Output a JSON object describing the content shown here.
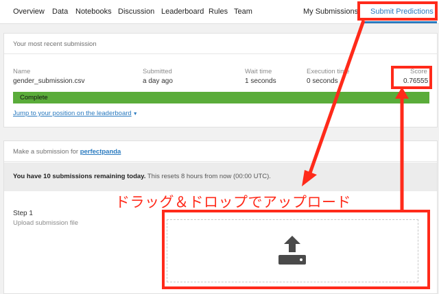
{
  "nav": {
    "items": [
      "Overview",
      "Data",
      "Notebooks",
      "Discussion",
      "Leaderboard",
      "Rules",
      "Team"
    ],
    "my_submissions": "My Submissions",
    "submit_predictions": "Submit Predictions"
  },
  "recent": {
    "header": "Your most recent submission",
    "columns": {
      "name": "Name",
      "submitted": "Submitted",
      "wait_time": "Wait time",
      "execution_time": "Execution time",
      "score": "Score"
    },
    "row": {
      "name": "gender_submission.csv",
      "submitted": "a day ago",
      "wait_time": "1 seconds",
      "execution_time": "0 seconds",
      "score": "0.76555"
    },
    "status": "Complete",
    "jump_link": "Jump to your position on the leaderboard"
  },
  "make_submission": {
    "prefix": "Make a submission for ",
    "user": "perfectpanda",
    "remaining_bold": "You have 10 submissions remaining today.",
    "remaining_rest": " This resets 8 hours from now (00:00 UTC).",
    "step_title": "Step 1",
    "step_sub": "Upload submission file"
  },
  "annotation": {
    "text": "ドラッグ＆ドロップでアップロード"
  },
  "colors": {
    "accent": "#2a7abf",
    "status_green": "#5aac3a",
    "annotation_red": "#ff2a1a"
  },
  "icons": {
    "upload": "upload-tray-icon",
    "caret": "caret-down-icon"
  }
}
